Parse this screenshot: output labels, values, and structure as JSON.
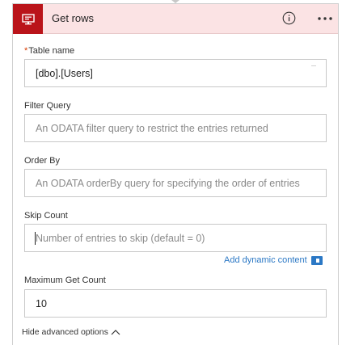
{
  "header": {
    "title": "Get rows",
    "accent_color": "#ba141a",
    "background_color": "#fbe3e4",
    "icon": "sql-server-icon",
    "info_icon": "info-icon",
    "menu_icon": "more-options-icon"
  },
  "fields": {
    "table_name": {
      "required_mark": "*",
      "label": "Table name",
      "value": "[dbo].[Users]"
    },
    "filter_query": {
      "label": "Filter Query",
      "placeholder": "An ODATA filter query to restrict the entries returned"
    },
    "order_by": {
      "label": "Order By",
      "placeholder": "An ODATA orderBy query for specifying the order of entries"
    },
    "skip_count": {
      "label": "Skip Count",
      "placeholder": "Number of entries to skip (default = 0)"
    },
    "maximum_get_count": {
      "label": "Maximum Get Count",
      "value": "10"
    }
  },
  "dynamic_content": {
    "label": "Add dynamic content",
    "color": "#2b78c5"
  },
  "advanced_toggle": {
    "label": "Hide advanced options"
  }
}
